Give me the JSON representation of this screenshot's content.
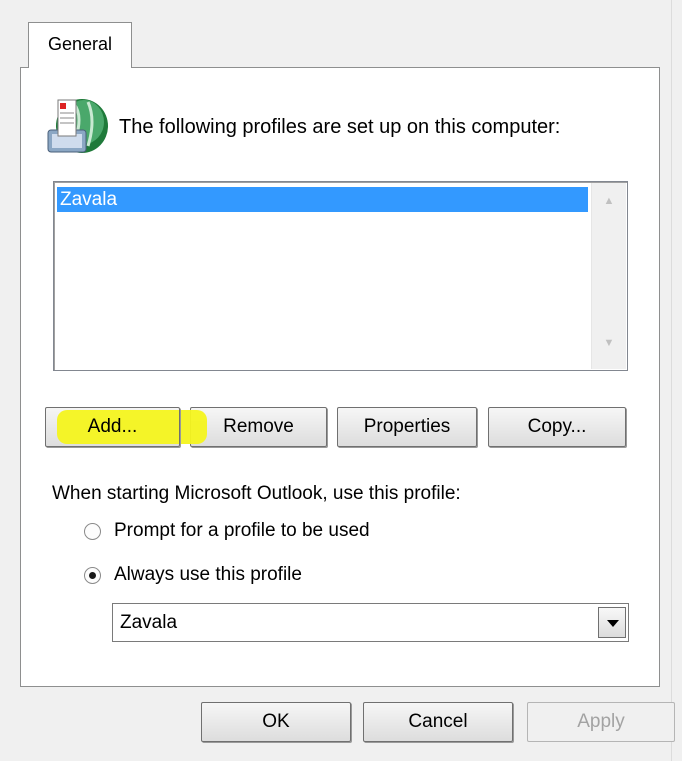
{
  "tabs": [
    {
      "label": "General",
      "selected": true
    }
  ],
  "header": {
    "text": "The following profiles are set up on this computer:",
    "icon": "mail-profile-icon"
  },
  "profiles_list": {
    "items": [
      "Zavala"
    ],
    "selected_index": 0
  },
  "profile_buttons": {
    "add": "Add...",
    "remove": "Remove",
    "properties": "Properties",
    "copy": "Copy..."
  },
  "startup": {
    "label": "When starting Microsoft Outlook, use this profile:",
    "options": [
      {
        "label": "Prompt for a profile to be used",
        "selected": false
      },
      {
        "label": "Always use this profile",
        "selected": true
      }
    ],
    "selected_profile": "Zavala"
  },
  "dialog_buttons": {
    "ok": "OK",
    "cancel": "Cancel",
    "apply": "Apply",
    "apply_disabled": true
  },
  "colors": {
    "selection": "#3399ff",
    "highlight": "#f4f41e"
  }
}
